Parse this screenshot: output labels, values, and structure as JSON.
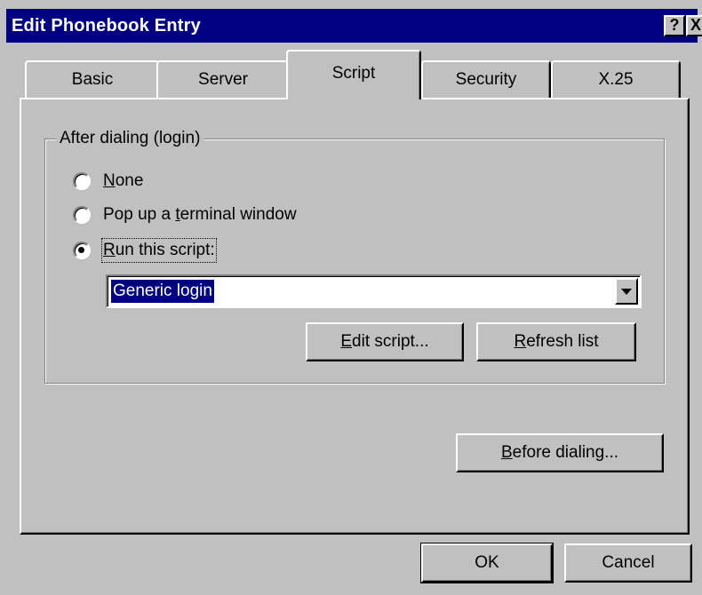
{
  "window": {
    "title": "Edit Phonebook Entry",
    "help_glyph": "?",
    "close_glyph": "X"
  },
  "tabs": [
    {
      "label": "Basic"
    },
    {
      "label": "Server"
    },
    {
      "label": "Script",
      "active": true
    },
    {
      "label": "Security"
    },
    {
      "label": "X.25"
    }
  ],
  "after_dialing": {
    "group_label": "After dialing (login)",
    "options": [
      {
        "pre": "",
        "key": "N",
        "post": "one",
        "checked": false
      },
      {
        "pre": "Pop up a ",
        "key": "t",
        "post": "erminal window",
        "checked": false
      },
      {
        "pre": "",
        "key": "R",
        "post": "un this script:",
        "checked": true
      }
    ],
    "script_select": {
      "selected": "Generic login"
    },
    "edit_script": {
      "key": "E",
      "post": "dit script..."
    },
    "refresh_list": {
      "key": "R",
      "post": "efresh list"
    }
  },
  "before_dialing": {
    "key": "B",
    "post": "efore dialing..."
  },
  "footer": {
    "ok_label": "OK",
    "cancel_label": "Cancel"
  },
  "colors": {
    "titlebar": "#000080",
    "face": "#c0c0c0",
    "selection": "#000080"
  }
}
